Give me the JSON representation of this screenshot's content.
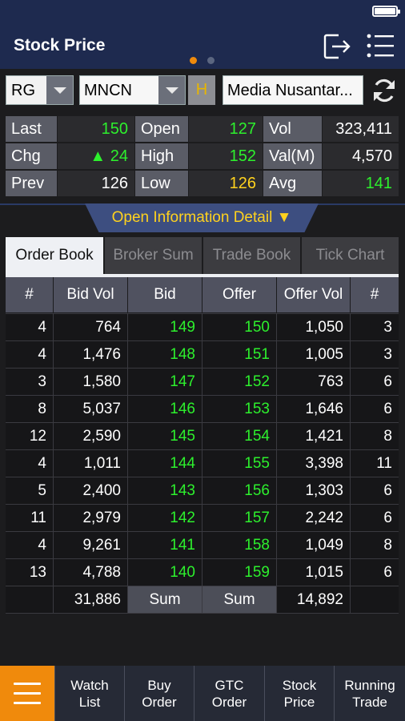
{
  "header": {
    "title": "Stock Price"
  },
  "pager": {
    "active_color": "#f08a0c",
    "inactive_color": "#5b6680"
  },
  "selector": {
    "board": "RG",
    "code": "MNCN",
    "h_label": "H",
    "company_name": "Media Nusantar..."
  },
  "stats": {
    "last": {
      "label": "Last",
      "value": "150"
    },
    "chg": {
      "label": "Chg",
      "value": "▲ 24"
    },
    "prev": {
      "label": "Prev",
      "value": "126"
    },
    "open": {
      "label": "Open",
      "value": "127"
    },
    "high": {
      "label": "High",
      "value": "152"
    },
    "low": {
      "label": "Low",
      "value": "126"
    },
    "vol": {
      "label": "Vol",
      "value": "323,411"
    },
    "valm": {
      "label": "Val(M)",
      "value": "4,570"
    },
    "avg": {
      "label": "Avg",
      "value": "141"
    }
  },
  "info_toggle": {
    "label": "Open Information Detail ▼"
  },
  "tabs": [
    "Order Book",
    "Broker Sum",
    "Trade Book",
    "Tick Chart"
  ],
  "order_book": {
    "headers": [
      "#",
      "Bid Vol",
      "Bid",
      "Offer",
      "Offer Vol",
      "#"
    ],
    "rows": [
      [
        "4",
        "764",
        "149",
        "150",
        "1,050",
        "3"
      ],
      [
        "4",
        "1,476",
        "148",
        "151",
        "1,005",
        "3"
      ],
      [
        "3",
        "1,580",
        "147",
        "152",
        "763",
        "6"
      ],
      [
        "8",
        "5,037",
        "146",
        "153",
        "1,646",
        "6"
      ],
      [
        "12",
        "2,590",
        "145",
        "154",
        "1,421",
        "8"
      ],
      [
        "4",
        "1,011",
        "144",
        "155",
        "3,398",
        "11"
      ],
      [
        "5",
        "2,400",
        "143",
        "156",
        "1,303",
        "6"
      ],
      [
        "11",
        "2,979",
        "142",
        "157",
        "2,242",
        "6"
      ],
      [
        "4",
        "9,261",
        "141",
        "158",
        "1,049",
        "8"
      ],
      [
        "13",
        "4,788",
        "140",
        "159",
        "1,015",
        "6"
      ]
    ],
    "totals": {
      "bid_vol": "31,886",
      "bid_label": "Sum",
      "offer_label": "Sum",
      "offer_vol": "14,892"
    }
  },
  "bottom_nav": {
    "items": [
      [
        "Watch",
        "List"
      ],
      [
        "Buy",
        "Order"
      ],
      [
        "GTC",
        "Order"
      ],
      [
        "Stock",
        "Price"
      ],
      [
        "Running",
        "Trade"
      ]
    ]
  },
  "colors": {
    "up_green": "#2df02d",
    "unchanged_yellow": "#ffd21e",
    "accent_orange": "#f08a0c",
    "header_navy": "#1e2a4f"
  }
}
